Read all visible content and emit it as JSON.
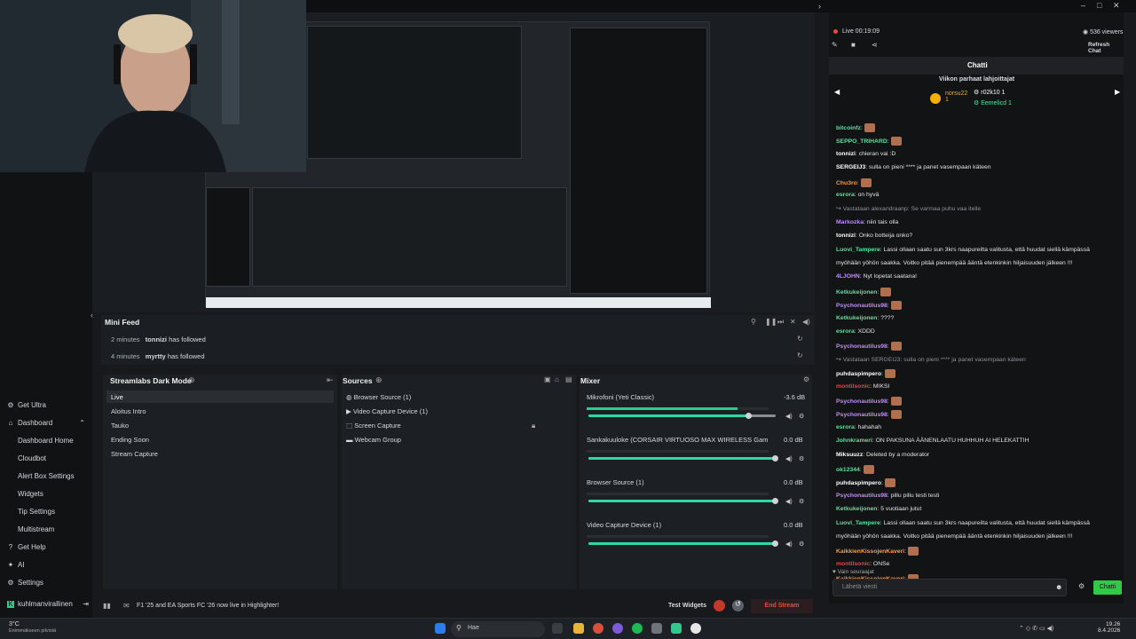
{
  "title_bar": {
    "minimize": "–",
    "maximize": "□",
    "close": "✕"
  },
  "sidebar": {
    "items": [
      {
        "label": "Get Ultra",
        "icon": "ultra-icon"
      },
      {
        "label": "Dashboard",
        "icon": "dashboard-icon"
      },
      {
        "label": "Dashboard Home"
      },
      {
        "label": "Cloudbot"
      },
      {
        "label": "Alert Box Settings"
      },
      {
        "label": "Widgets"
      },
      {
        "label": "Tip Settings"
      },
      {
        "label": "Multistream"
      },
      {
        "label": "Get Help",
        "icon": "help-icon"
      },
      {
        "label": "AI",
        "icon": "ai-icon"
      },
      {
        "label": "Settings",
        "icon": "settings-icon"
      }
    ],
    "user": "kuhlmanvirallinen"
  },
  "mini_feed": {
    "title": "Mini Feed",
    "events": [
      {
        "time": "2 minutes",
        "user": "tonnizi",
        "action": "has followed"
      },
      {
        "time": "4 minutes",
        "user": "myrtty",
        "action": "has followed"
      }
    ]
  },
  "scenes": {
    "title": "Streamlabs Dark Mode",
    "items": [
      "Live",
      "Aloitus Intro",
      "Tauko",
      "Ending Soon",
      "Stream Capture"
    ]
  },
  "sources": {
    "title": "Sources",
    "items": [
      "Browser Source (1)",
      "Video Capture Device (1)",
      "Screen Capture",
      "Webcam Group"
    ]
  },
  "mixer": {
    "title": "Mixer",
    "channels": [
      {
        "name": "Mikrofoni (Yeti Classic)",
        "db": "-3.6 dB",
        "level": 0.86,
        "meter": 0.83
      },
      {
        "name": "Sankakuuloke (CORSAIR VIRTUOSO MAX WIRELESS Gaming Recei...",
        "db": "0.0 dB",
        "level": 1.0,
        "meter": 0
      },
      {
        "name": "Browser Source (1)",
        "db": "0.0 dB",
        "level": 1.0,
        "meter": 0
      },
      {
        "name": "Video Capture Device (1)",
        "db": "0.0 dB",
        "level": 1.0,
        "meter": 0
      }
    ]
  },
  "footer": {
    "news": "F1 '25 and EA Sports FC '26 now live in Highlighter!",
    "test_widgets": "Test Widgets",
    "end_stream": "End Stream"
  },
  "chat": {
    "live_label": "Live",
    "live_time": "00:19:09",
    "viewers": "536 viewers",
    "refresh": "Refresh Chat",
    "tab": "Chatti",
    "gifters_title": "Viikon parhaat lahjoittajat",
    "gifters": [
      {
        "name": "norsu22",
        "count": "1"
      },
      {
        "name": "r02k10",
        "count": "1"
      },
      {
        "name": "Eemelicd",
        "count": "1"
      }
    ],
    "messages": [
      {
        "user": "bitcoinfz",
        "color": "#56e39f",
        "text": "",
        "emote": true
      },
      {
        "user": "SEPPO_TRIHARD",
        "color": "#56e39f",
        "text": "",
        "emote": true
      },
      {
        "user": "tonnizi",
        "color": "#ffffff",
        "text": "chieran vai :D"
      },
      {
        "user": "SERGEIJ3",
        "color": "#ffffff",
        "text": "sulla on pieni **** ja panet vasempaan käteen"
      },
      {
        "user": "Chu3ro",
        "color": "#ff9b3d",
        "text": "",
        "emote": true
      },
      {
        "user": "esrora",
        "color": "#56e39f",
        "text": "on hyvä"
      },
      {
        "system": "Vastataan alexandraanp: Se varmaa puhu vaa itelle"
      },
      {
        "user": "Markozka",
        "color": "#c08cff",
        "text": "niin tais olla"
      },
      {
        "user": "tonnizi",
        "color": "#ffffff",
        "text": "Onko botteija onko?"
      },
      {
        "user": "Luovi_Tampere",
        "color": "#56e39f",
        "text": "Lassi ollaan saatu sun 3krs naapureilta valitusta, että huudat siellä kämpässä"
      },
      {
        "cont": "myöhään yöhön saakka. Voitko pitää pienempää ääntä etenkinkin hiljaisuuden jälkeen !!!"
      },
      {
        "user": "4LJOHN",
        "color": "#c08cff",
        "text": "Nyt lopetat saatana!"
      },
      {
        "user": "Ketkukeijonen",
        "color": "#56e39f",
        "text": "",
        "emote": true
      },
      {
        "user": "Psychonautilus98",
        "color": "#c08cff",
        "text": "",
        "emote": true
      },
      {
        "user": "Ketkukeijonen",
        "color": "#56e39f",
        "text": "????"
      },
      {
        "user": "esrora",
        "color": "#56e39f",
        "text": "XDDD"
      },
      {
        "user": "Psychonautilus98",
        "color": "#c08cff",
        "text": "",
        "emote": true
      },
      {
        "system": "Vastataan SERGEIJ3: sulla on pieni **** ja panet vasempaan käteen"
      },
      {
        "user": "puhdaspimpero",
        "color": "#ffffff",
        "text": "",
        "emote": true
      },
      {
        "user": "montilsonic",
        "color": "#ff3b3b",
        "text": "MIKSI"
      },
      {
        "user": "Psychonautilus98",
        "color": "#c08cff",
        "text": "",
        "emote": true
      },
      {
        "user": "Psychonautilus98",
        "color": "#c08cff",
        "text": "",
        "emote": true
      },
      {
        "user": "esrora",
        "color": "#56e39f",
        "text": "hahahah"
      },
      {
        "user": "Johnkrameri",
        "color": "#56e39f",
        "text": "ON PAKSUNA ÄÄNENLAATU HUHHUH AI HELEKATTIH"
      },
      {
        "user": "Miksuuzz",
        "color": "#ffffff",
        "text": "Deleted by a moderator"
      },
      {
        "user": "ok12344",
        "color": "#56e39f",
        "text": "",
        "emote": true
      },
      {
        "user": "puhdaspimpero",
        "color": "#ffffff",
        "text": "",
        "emote": true
      },
      {
        "user": "Psychonautilus98",
        "color": "#c08cff",
        "text": "pillu pillu testi testi"
      },
      {
        "user": "Ketkukeijonen",
        "color": "#56e39f",
        "text": "5 vuotiaan jutut"
      },
      {
        "user": "Luovi_Tampere",
        "color": "#56e39f",
        "text": "Lassi ollaan saatu sun 3krs naapureilta valitusta, että huudat siellä kämpässä"
      },
      {
        "cont": "myöhään yöhön saakka. Voitko pitää pienempää ääntä etenkinkin hiljaisuuden jälkeen !!!"
      },
      {
        "user": "KaikkienKissojenKaveri",
        "color": "#ff9b3d",
        "text": "",
        "emote": true
      },
      {
        "user": "montilsonic",
        "color": "#ff3b3b",
        "text": "ONSe"
      },
      {
        "user": "KaikkienKissojenKaveri",
        "color": "#ff9b3d",
        "text": "",
        "emote": true
      }
    ],
    "followers_only": "Vain seuraajat",
    "input_placeholder": "Lähetä viesti",
    "send": "Chatti"
  },
  "taskbar": {
    "weather_temp": "3°C",
    "weather_text": "Enimmäkseen pilvistä",
    "search": "Hae",
    "time": "19.26",
    "date": "8.4.2026"
  }
}
